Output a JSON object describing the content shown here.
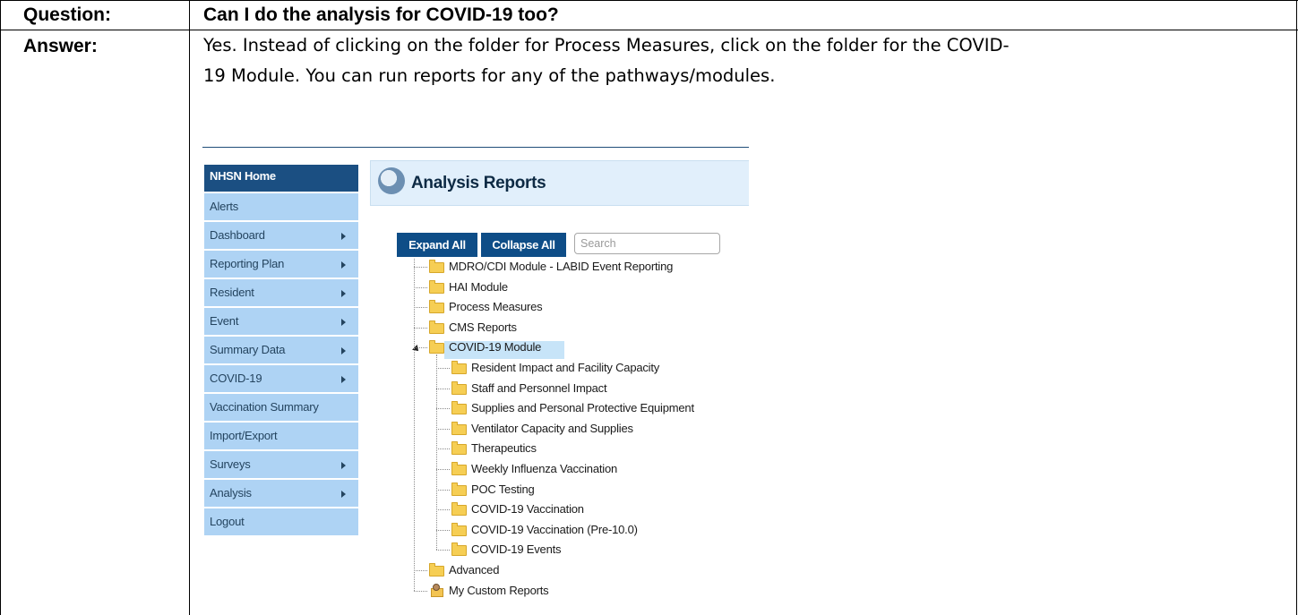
{
  "question": {
    "label": "Question:",
    "text": "Can I do the analysis for COVID-19 too?"
  },
  "answer": {
    "label": "Answer:",
    "line1": "Yes. Instead of clicking on the folder for Process Measures, click on the folder for the COVID-",
    "line2": "19 Module. You can run reports for any of the pathways/modules."
  },
  "screenshot": {
    "sidebar": {
      "home": "NHSN Home",
      "items": [
        {
          "label": "Alerts",
          "has_submenu": false
        },
        {
          "label": "Dashboard",
          "has_submenu": true
        },
        {
          "label": "Reporting Plan",
          "has_submenu": true
        },
        {
          "label": "Resident",
          "has_submenu": true
        },
        {
          "label": "Event",
          "has_submenu": true
        },
        {
          "label": "Summary Data",
          "has_submenu": true
        },
        {
          "label": "COVID-19",
          "has_submenu": true
        },
        {
          "label": "Vaccination Summary",
          "has_submenu": false
        },
        {
          "label": "Import/Export",
          "has_submenu": false
        },
        {
          "label": "Surveys",
          "has_submenu": true
        },
        {
          "label": "Analysis",
          "has_submenu": true
        },
        {
          "label": "Logout",
          "has_submenu": false
        }
      ]
    },
    "panel": {
      "title": "Analysis Reports",
      "icon": "analysis-reports-icon",
      "expand_label": "Expand All",
      "collapse_label": "Collapse All",
      "search_placeholder": "Search"
    },
    "tree": {
      "top": [
        "MDRO/CDI Module - LABID Event Reporting",
        "HAI Module",
        "Process Measures",
        "CMS Reports",
        "COVID-19 Module"
      ],
      "covid_children": [
        "Resident Impact and Facility Capacity",
        "Staff and Personnel Impact",
        "Supplies and Personal Protective Equipment",
        "Ventilator Capacity and Supplies",
        "Therapeutics",
        "Weekly Influenza Vaccination",
        "POC Testing",
        "COVID-19 Vaccination",
        "COVID-19 Vaccination (Pre-10.0)",
        "COVID-19 Events"
      ],
      "bottom": [
        "Advanced",
        "My Custom Reports"
      ],
      "selected": "COVID-19 Module"
    },
    "colors": {
      "nav_dark": "#1b4f82",
      "nav_item": "#aed3f4",
      "button": "#0e4d87",
      "header_bg": "#e1effb",
      "selection": "#c7e4f8"
    }
  }
}
